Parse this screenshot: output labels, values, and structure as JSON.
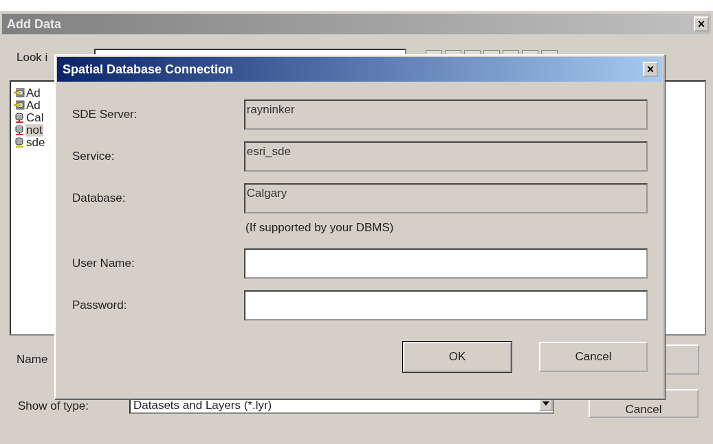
{
  "add_data_window": {
    "title": "Add Data",
    "close": "×",
    "look_in_label": "Look i",
    "items": [
      {
        "name": "Ad",
        "kind": "add",
        "selected": false
      },
      {
        "name": "Ad",
        "kind": "add",
        "selected": false
      },
      {
        "name": "Cal",
        "kind": "broken",
        "selected": false
      },
      {
        "name": "not",
        "kind": "broken",
        "selected": true
      },
      {
        "name": "sde",
        "kind": "database",
        "selected": false
      }
    ],
    "name_label": "Name",
    "show_type_label": "Show of type:",
    "show_type_value": "Datasets and Layers (*.lyr)",
    "cancel_button": "Cancel"
  },
  "connection_dialog": {
    "title": "Spatial Database Connection",
    "close": "×",
    "fields": [
      {
        "label": "SDE Server:",
        "value": "rayninker",
        "disabled": true
      },
      {
        "label": "Service:",
        "value": "esri_sde",
        "disabled": true
      },
      {
        "label": "Database:",
        "value": "Calgary",
        "disabled": true,
        "hint": "(If supported by your DBMS)"
      },
      {
        "label": "User Name:",
        "disabled": false
      },
      {
        "label": "Password:",
        "disabled": false
      }
    ],
    "buttons": [
      {
        "label": "OK",
        "default": true
      },
      {
        "label": "Cancel",
        "default": false
      }
    ]
  }
}
